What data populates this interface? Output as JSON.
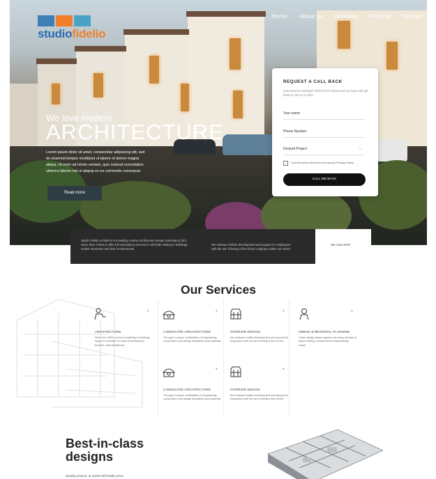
{
  "brand": {
    "name_part1": "studio",
    "name_part2": "fidelio",
    "colors": [
      "#3e7fb8",
      "#f07f2c",
      "#2e6da8",
      "#4aa3c4",
      "#e2662a",
      "#2b6cb0"
    ]
  },
  "nav": {
    "items": [
      "Home",
      "About us",
      "Services",
      "Projects",
      "Contact"
    ]
  },
  "hero": {
    "tagline": "We love modern",
    "headline": "ARCHITECTURE",
    "text_lines": [
      "Lorem ipsum dolor sit amet, consectetur adipiscing elit, sed",
      "do eiusmod tempor incididunt ut labore et dolore magna",
      "aliqua. Ut enim ad minim veniam, quis nostrud exercitation",
      "ullamco laboris nisi ut aliquip ex ea commodo consequat."
    ],
    "read_more": "Read more"
  },
  "form": {
    "title": "REQUEST A CALL BACK",
    "subtitle": "Interested in working? Fill the form below and our team will get back to you in no time.",
    "name_placeholder": "Your name",
    "phone_placeholder": "Phone Number",
    "project_select": "Desired Project",
    "consent": "I am bound by the terms and accept Privacy Policy",
    "submit": "CALL ME BACK"
  },
  "intro": {
    "col1": "Studio Fidelio Architects is a leading creative architecture design consultancy firm. Since 2011 it aims to offer full consultancy services in all fields relating to buildings, master structures and their environments.",
    "col2": "We embrace holistic development and support for employees with the aim of being a first choice employer within our sector.",
    "side_label": "WE CAN HOPE"
  },
  "services": {
    "title": "Our Services",
    "cards": [
      {
        "title": "ARCHITECTURE",
        "desc": "Since the 1990s, as the complexity of buildings began to increase, the field of architecture became multi-disciplinary.",
        "icon": "architect-icon"
      },
      {
        "title": "LANDSCAPE ARCHITECTURE",
        "desc": "Through a unique combination of engineering, construction and design disciplines and expertise.",
        "icon": "landscape-icon"
      },
      {
        "title": "INTERIOR DESIGN",
        "desc": "We embrace holistic development and support for employees with the aim of being a first choice.",
        "icon": "interior-icon"
      },
      {
        "title": "URBAN & REGIONAL PLANNING",
        "desc": "Urban design draws together the many strands of place-making, environmental responsibility, social.",
        "icon": "planning-icon"
      },
      {
        "title": "LANDSCAPE ARCHITECTURE",
        "desc": "Through a unique combination of engineering, construction and design disciplines and expertise.",
        "icon": "landscape-icon"
      },
      {
        "title": "INTERIOR DESIGN",
        "desc": "We embrace holistic development and support for employees with the aim of being a first choice.",
        "icon": "interior-icon"
      }
    ]
  },
  "best": {
    "title": "Best-in-class designs",
    "subtitle": "Quality product, at lowest affordable price."
  }
}
